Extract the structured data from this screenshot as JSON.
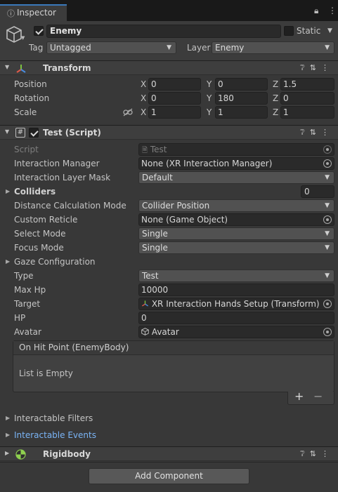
{
  "tab": {
    "icon": "info-icon",
    "label": "Inspector"
  },
  "tab_actions": {
    "lock": "lock-icon",
    "menu": "kebab-menu-icon"
  },
  "object": {
    "name": "Enemy",
    "active": true,
    "static_label": "Static",
    "static_checked": false,
    "tag_label": "Tag",
    "tag_value": "Untagged",
    "layer_label": "Layer",
    "layer_value": "Enemy"
  },
  "transform": {
    "title": "Transform",
    "rows": [
      {
        "label": "Position",
        "x": "0",
        "y": "0",
        "z": "1.5"
      },
      {
        "label": "Rotation",
        "x": "0",
        "y": "180",
        "z": "0"
      },
      {
        "label": "Scale",
        "x": "1",
        "y": "1",
        "z": "1"
      }
    ],
    "axes": {
      "x": "X",
      "y": "Y",
      "z": "Z"
    }
  },
  "script_component": {
    "title": "Test (Script)",
    "enabled": true,
    "script": {
      "label": "Script",
      "value": "Test"
    },
    "interaction_manager": {
      "label": "Interaction Manager",
      "value": "None (XR Interaction Manager)"
    },
    "interaction_layer_mask": {
      "label": "Interaction Layer Mask",
      "value": "Default"
    },
    "colliders": {
      "label": "Colliders",
      "value": "0"
    },
    "distance_calc": {
      "label": "Distance Calculation Mode",
      "value": "Collider Position"
    },
    "custom_reticle": {
      "label": "Custom Reticle",
      "value": "None (Game Object)"
    },
    "select_mode": {
      "label": "Select Mode",
      "value": "Single"
    },
    "focus_mode": {
      "label": "Focus Mode",
      "value": "Single"
    },
    "gaze_config": {
      "label": "Gaze Configuration"
    },
    "type": {
      "label": "Type",
      "value": "Test"
    },
    "max_hp": {
      "label": "Max Hp",
      "value": "10000"
    },
    "target": {
      "label": "Target",
      "value": "XR Interaction Hands Setup (Transform)"
    },
    "hp": {
      "label": "HP",
      "value": "0"
    },
    "avatar": {
      "label": "Avatar",
      "value": "Avatar"
    },
    "event_list": {
      "title": "On Hit Point (EnemyBody)",
      "empty_text": "List is Empty",
      "add": "+",
      "remove": "−"
    },
    "interactable_filters": {
      "label": "Interactable Filters"
    },
    "interactable_events": {
      "label": "Interactable Events"
    }
  },
  "rigidbody": {
    "title": "Rigidbody"
  },
  "add_component": {
    "label": "Add Component"
  },
  "colors": {
    "accent_blue": "#7ab4f5",
    "tab_highlight": "#3a79bb",
    "background": "#383838"
  }
}
